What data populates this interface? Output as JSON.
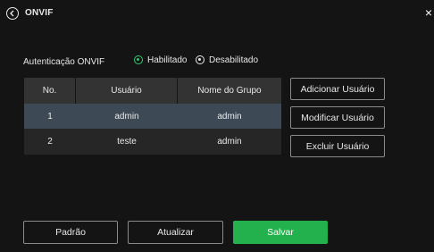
{
  "header": {
    "title": "ONVIF",
    "close_glyph": "×"
  },
  "auth": {
    "label": "Autenticação ONVIF",
    "options": [
      {
        "label": "Habilitado",
        "selected": true
      },
      {
        "label": "Desabilitado",
        "selected": false
      }
    ],
    "selected_color": "#2ecc71"
  },
  "table": {
    "columns": [
      "No.",
      "Usuário",
      "Nome do Grupo"
    ],
    "rows": [
      {
        "no": "1",
        "user": "admin",
        "group": "admin",
        "selected": true
      },
      {
        "no": "2",
        "user": "teste",
        "group": "admin",
        "selected": false
      }
    ]
  },
  "actions": {
    "add": "Adicionar Usuário",
    "modify": "Modificar Usuário",
    "delete": "Excluir Usuário"
  },
  "footer": {
    "default": "Padrão",
    "refresh": "Atualizar",
    "save": "Salvar"
  },
  "colors": {
    "background": "#141414",
    "accent": "#22b14c",
    "selected_row": "#3d4a56"
  },
  "icons": {
    "back": "chevron-left-circle-icon",
    "close": "close-icon"
  }
}
